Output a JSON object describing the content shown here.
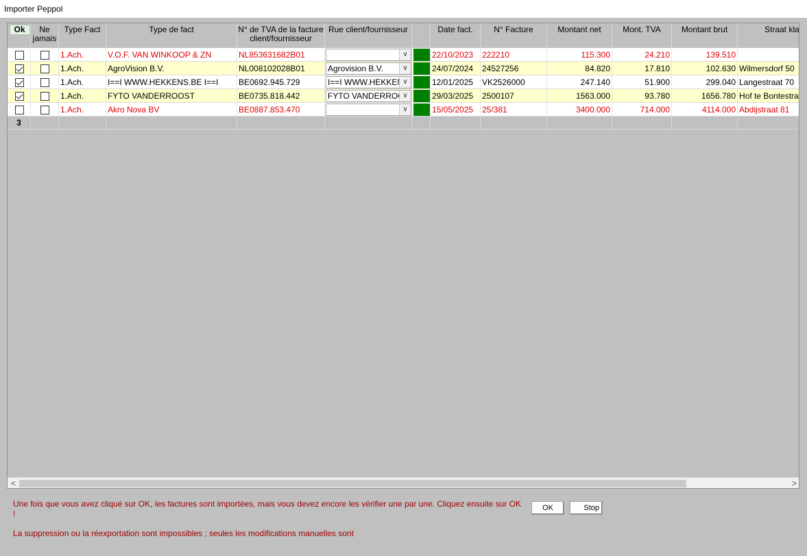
{
  "window": {
    "title": "Importer Peppol"
  },
  "grid": {
    "headers": {
      "ok": "Ok",
      "ne_jamais": "Ne jamais",
      "type_fact": "Type Fact",
      "type_de_fact": "Type de fact",
      "tva": "N° de TVA de la facture client/fournisseur",
      "rue": "Rue client/fournisseur",
      "blank": "",
      "date": "Date fact.",
      "num": "N° Facture",
      "net": "Montant net",
      "tva_amt": "Mont. TVA",
      "brut": "Montant brut",
      "straat": "Straat kla"
    },
    "rows": [
      {
        "ok": false,
        "ne_jamais": false,
        "type_fact": "1.Ach.",
        "name": "V.O.F. VAN WINKOOP & ZN",
        "tva": "NL853631682B01",
        "rue": "",
        "date": "22/10/2023",
        "num": "222210",
        "net": "115.300",
        "tva_amt": "24.210",
        "brut": "139.510",
        "straat": "",
        "color": "red",
        "bg": "white"
      },
      {
        "ok": true,
        "ne_jamais": false,
        "type_fact": "1.Ach.",
        "name": "AgroVision B.V.",
        "tva": "NL008102028B01",
        "rue": "Agrovision B.V.",
        "date": "24/07/2024",
        "num": "24527256",
        "net": "84.820",
        "tva_amt": "17.810",
        "brut": "102.630",
        "straat": "Wilmersdorf 50",
        "color": "black",
        "bg": "yellow"
      },
      {
        "ok": true,
        "ne_jamais": false,
        "type_fact": "1.Ach.",
        "name": "I==I WWW.HEKKENS.BE I==I",
        "tva": "BE0692.945.729",
        "rue": "I==I WWW.HEKKEN",
        "date": "12/01/2025",
        "num": "VK2526000",
        "net": "247.140",
        "tva_amt": "51.900",
        "brut": "299.040",
        "straat": "Langestraat 70",
        "color": "black",
        "bg": "white"
      },
      {
        "ok": true,
        "ne_jamais": false,
        "type_fact": "1.Ach.",
        "name": "FYTO VANDERROOST",
        "tva": "BE0735.818.442",
        "rue": "FYTO VANDERROO",
        "date": "29/03/2025",
        "num": "2500107",
        "net": "1563.000",
        "tva_amt": "93.780",
        "brut": "1656.780",
        "straat": "Hof te Bontestra",
        "color": "black",
        "bg": "yellow"
      },
      {
        "ok": false,
        "ne_jamais": false,
        "type_fact": "1.Ach.",
        "name": "Akro Nova BV",
        "tva": "BE0887.853.470",
        "rue": "",
        "date": "15/05/2025",
        "num": "25/381",
        "net": "3400.000",
        "tva_amt": "714.000",
        "brut": "4114.000",
        "straat": "Abdijstraat 81",
        "color": "red",
        "bg": "white"
      }
    ],
    "count": "3",
    "status_color": "#008000"
  },
  "scrollbar": {
    "left": "<",
    "right": ">"
  },
  "footer": {
    "message1": "Une fois que vous avez cliqué sur OK, les factures sont importées, mais vous devez encore les vérifier une par une. Cliquez ensuite sur OK !",
    "message2": "La suppression ou la réexportation sont impossibles ; seules les modifications manuelles sont",
    "ok_label": "OK",
    "stop_label": "Stop"
  },
  "colors": {
    "red_text": "#e00000",
    "message": "#a00000",
    "row_highlight": "#ffffcc"
  }
}
